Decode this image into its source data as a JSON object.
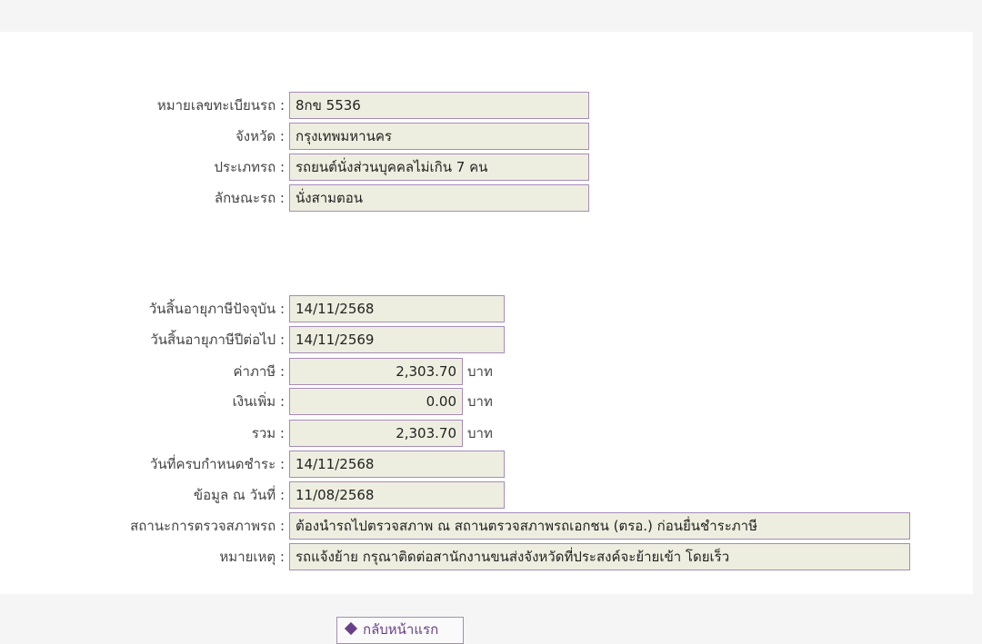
{
  "vehicle": {
    "plate": {
      "label": "หมายเลขทะเบียนรถ :",
      "value": "8กข 5536"
    },
    "province": {
      "label": "จังหวัด :",
      "value": "กรุงเทพมหานคร"
    },
    "type": {
      "label": "ประเภทรถ :",
      "value": "รถยนต์นั่งส่วนบุคคลไม่เกิน 7 คน"
    },
    "body": {
      "label": "ลักษณะรถ :",
      "value": "นั่งสามตอน"
    }
  },
  "tax": {
    "expire_current": {
      "label": "วันสิ้นอายุภาษีปัจจุบัน :",
      "value": "14/11/2568"
    },
    "expire_next": {
      "label": "วันสิ้นอายุภาษีปีต่อไป :",
      "value": "14/11/2569"
    },
    "tax_amount": {
      "label": "ค่าภาษี :",
      "value": "2,303.70",
      "unit": "บาท"
    },
    "surcharge": {
      "label": "เงินเพิ่ม :",
      "value": "0.00",
      "unit": "บาท"
    },
    "total": {
      "label": "รวม :",
      "value": "2,303.70",
      "unit": "บาท"
    },
    "due_date": {
      "label": "วันที่ครบกำหนดชำระ :",
      "value": "14/11/2568"
    },
    "data_as_of": {
      "label": "ข้อมูล ณ วันที่ :",
      "value": "11/08/2568"
    },
    "inspection": {
      "label": "สถานะการตรวจสภาพรถ :",
      "value": "ต้องนำรถไปตรวจสภาพ ณ สถานตรวจสภาพรถเอกชน (ตรอ.) ก่อนยื่นชำระภาษี"
    },
    "remark": {
      "label": "หมายเหตุ :",
      "value": "รถแจ้งย้าย กรุณาติดต่อสานักงานขนส่งจังหวัดที่ประสงค์จะย้ายเข้า โดยเร็ว"
    }
  },
  "actions": {
    "back_label": "กลับหน้าแรก",
    "back_icon": "diamond-icon"
  }
}
